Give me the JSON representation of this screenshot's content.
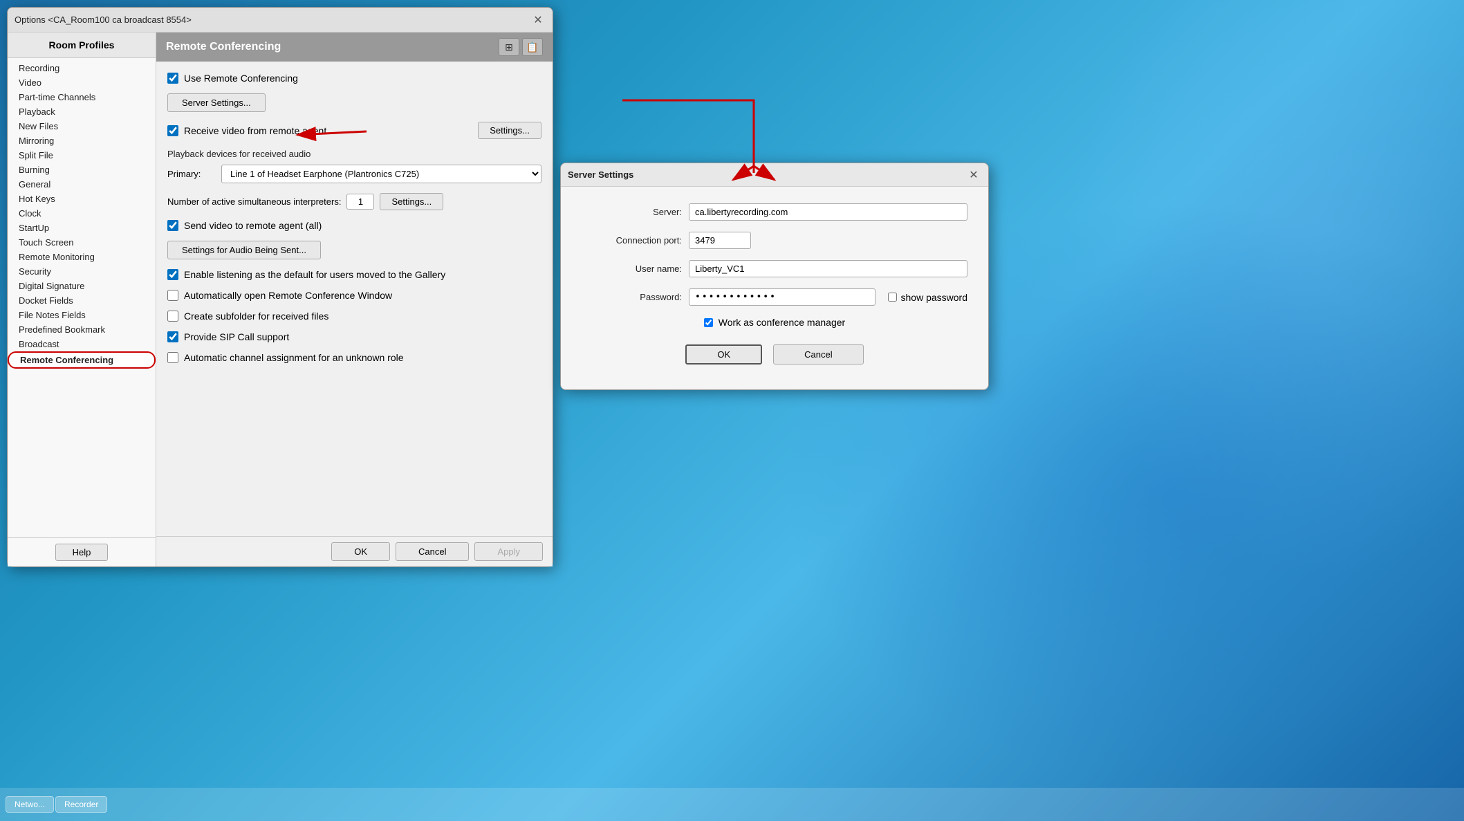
{
  "window": {
    "title": "Options <CA_Room100 ca broadcast 8554>",
    "close_label": "✕"
  },
  "sidebar": {
    "header": "Room Profiles",
    "items": [
      {
        "label": "Recording",
        "active": false
      },
      {
        "label": "Video",
        "active": false
      },
      {
        "label": "Part-time Channels",
        "active": false
      },
      {
        "label": "Playback",
        "active": false
      },
      {
        "label": "New Files",
        "active": false
      },
      {
        "label": "Mirroring",
        "active": false
      },
      {
        "label": "Split File",
        "active": false
      },
      {
        "label": "Burning",
        "active": false
      },
      {
        "label": "General",
        "active": false
      },
      {
        "label": "Hot Keys",
        "active": false
      },
      {
        "label": "Clock",
        "active": false
      },
      {
        "label": "StartUp",
        "active": false
      },
      {
        "label": "Touch Screen",
        "active": false
      },
      {
        "label": "Remote Monitoring",
        "active": false
      },
      {
        "label": "Security",
        "active": false
      },
      {
        "label": "Digital Signature",
        "active": false
      },
      {
        "label": "Docket Fields",
        "active": false
      },
      {
        "label": "File Notes Fields",
        "active": false
      },
      {
        "label": "Predefined Bookmark",
        "active": false
      },
      {
        "label": "Broadcast",
        "active": false
      },
      {
        "label": "Remote Conferencing",
        "active": true,
        "highlighted": true
      }
    ],
    "help_label": "Help"
  },
  "content": {
    "header": "Remote Conferencing",
    "icon1": "⊞",
    "icon2": "📋",
    "use_remote_conf_label": "Use Remote Conferencing",
    "use_remote_conf_checked": true,
    "server_settings_label": "Server Settings...",
    "receive_video_label": "Receive video from remote agent",
    "receive_video_checked": true,
    "receive_video_settings_label": "Settings...",
    "playback_devices_label": "Playback devices for received audio",
    "primary_label": "Primary:",
    "primary_option": "Line 1 of Headset Earphone (Plantronics C725)",
    "interpreters_label": "Number of active simultaneous interpreters:",
    "interpreters_value": "1",
    "interpreters_settings_label": "Settings...",
    "send_video_label": "Send video to remote agent (all)",
    "send_video_checked": true,
    "audio_sent_label": "Settings for Audio Being Sent...",
    "enable_listening_label": "Enable listening as the default for users moved to the Gallery",
    "enable_listening_checked": true,
    "auto_open_label": "Automatically open Remote Conference Window",
    "auto_open_checked": false,
    "create_subfolder_label": "Create subfolder for received files",
    "create_subfolder_checked": false,
    "sip_label": "Provide SIP Call support",
    "sip_checked": true,
    "auto_channel_label": "Automatic channel assignment for an unknown role",
    "auto_channel_checked": false
  },
  "footer": {
    "ok_label": "OK",
    "cancel_label": "Cancel",
    "apply_label": "Apply"
  },
  "server_dialog": {
    "title": "Server Settings",
    "close_label": "✕",
    "server_label": "Server:",
    "server_value": "ca.libertyrecording.com",
    "port_label": "Connection port:",
    "port_value": "3479",
    "username_label": "User name:",
    "username_value": "Liberty_VC1",
    "password_label": "Password:",
    "password_value": "************",
    "show_password_label": "show password",
    "show_password_checked": false,
    "conf_manager_label": "Work as conference manager",
    "conf_manager_checked": true,
    "ok_label": "OK",
    "cancel_label": "Cancel"
  },
  "taskbar": {
    "items": [
      "Netwo...",
      "Recorder"
    ]
  }
}
